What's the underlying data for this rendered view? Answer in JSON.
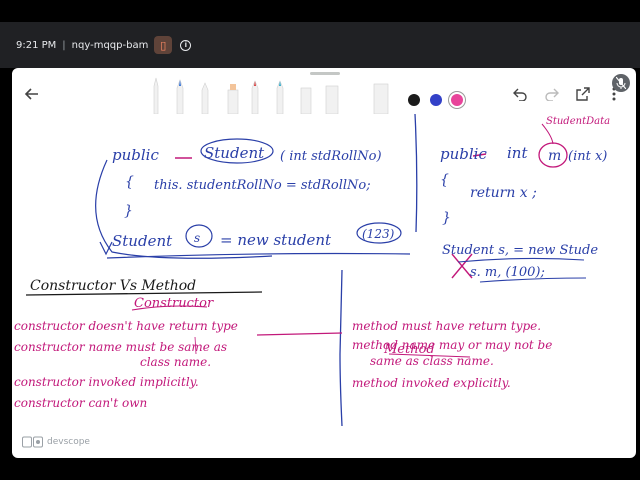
{
  "meet": {
    "time": "9:21 PM",
    "separator": "|",
    "meeting_code": "nqy-mqqp-bam"
  },
  "notes": {
    "code_left": {
      "line1_keyword": "public",
      "line1_name": "Student",
      "line1_params": "( int stdRollNo)",
      "line2": "this. studentRollNo = stdRollNo;",
      "open_brace": "{",
      "close_brace": "}",
      "line3_type": "Student",
      "line3_var": "s",
      "line3_rest": "= new student",
      "line3_arg": "(123)"
    },
    "code_right": {
      "line1_keyword": "public",
      "line1_type": "int",
      "line1_method": "m",
      "line1_params": "(int x)",
      "annotation": "StudentData",
      "open_brace": "{",
      "line2": "return x ;",
      "close_brace": "}",
      "line3": "Student s, = new Stude",
      "line4": "s. m, (100);"
    },
    "title": "Constructor Vs Method",
    "col_left": {
      "header": "Constructor",
      "items": [
        "constructor doesn't have return type",
        "constructor name must be same as",
        "class name.",
        "constructor invoked implicitly.",
        "constructor can't own"
      ]
    },
    "col_right": {
      "header": "Method",
      "items": [
        "method must have return type.",
        "method name may or may not be",
        "same as class name.",
        "method invoked explicitly."
      ]
    }
  },
  "watermark": "devscope",
  "colors": {
    "ink_blue": "#2a3fa8",
    "ink_pink": "#c2187a",
    "ink_black": "#1a1a1a",
    "dot_black": "#1b1b1b",
    "dot_blue": "#3341c8",
    "dot_pink": "#e8449a"
  }
}
